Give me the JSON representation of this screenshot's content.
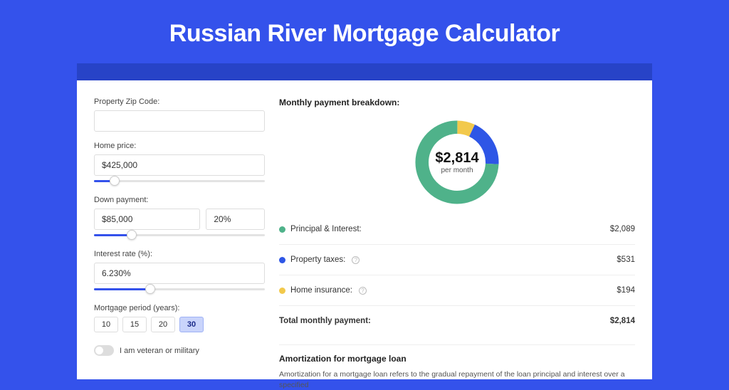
{
  "page_title": "Russian River Mortgage Calculator",
  "form": {
    "zip_label": "Property Zip Code:",
    "zip_value": "",
    "home_price_label": "Home price:",
    "home_price_value": "$425,000",
    "down_payment_label": "Down payment:",
    "down_payment_amount": "$85,000",
    "down_payment_percent": "20%",
    "interest_label": "Interest rate (%):",
    "interest_value": "6.230%",
    "period_label": "Mortgage period (years):",
    "period_options": [
      "10",
      "15",
      "20",
      "30"
    ],
    "period_selected": "30",
    "veteran_label": "I am veteran or military",
    "veteran_on": false
  },
  "breakdown": {
    "title": "Monthly payment breakdown:",
    "center_amount": "$2,814",
    "center_sub": "per month",
    "rows": [
      {
        "label": "Principal & Interest:",
        "amount": "$2,089",
        "color": "#4fb28a",
        "info": false
      },
      {
        "label": "Property taxes:",
        "amount": "$531",
        "color": "#2e56e6",
        "info": true
      },
      {
        "label": "Home insurance:",
        "amount": "$194",
        "color": "#f2c94c",
        "info": true
      }
    ],
    "total_label": "Total monthly payment:",
    "total_amount": "$2,814"
  },
  "amortization": {
    "title": "Amortization for mortgage loan",
    "body": "Amortization for a mortgage loan refers to the gradual repayment of the loan principal and interest over a specified"
  },
  "chart_data": {
    "type": "pie",
    "title": "Monthly payment breakdown",
    "series": [
      {
        "name": "Principal & Interest",
        "value": 2089,
        "color": "#4fb28a"
      },
      {
        "name": "Property taxes",
        "value": 531,
        "color": "#2e56e6"
      },
      {
        "name": "Home insurance",
        "value": 194,
        "color": "#f2c94c"
      }
    ],
    "total": 2814
  }
}
